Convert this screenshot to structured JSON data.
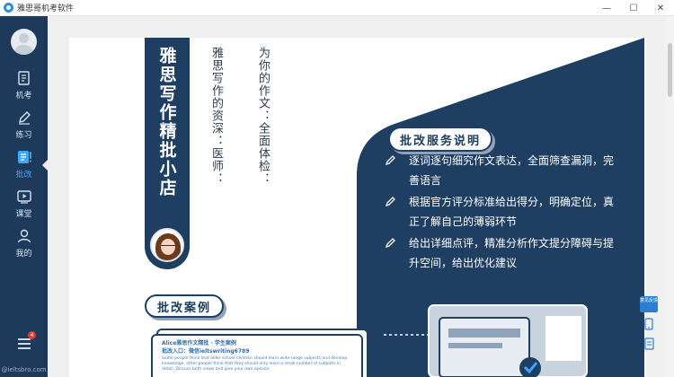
{
  "window": {
    "title": "雅思哥机考软件",
    "controls": {
      "minimize": "—",
      "maximize": "☐",
      "close": "✕"
    }
  },
  "sidebar": {
    "items": [
      {
        "label": "机考",
        "icon": "exam-icon"
      },
      {
        "label": "练习",
        "icon": "pen-icon"
      },
      {
        "label": "批改",
        "icon": "correction-icon",
        "active": true
      },
      {
        "label": "课堂",
        "icon": "video-icon"
      },
      {
        "label": "我的",
        "icon": "user-icon"
      }
    ],
    "menu_badge": "4",
    "site_url": "@ieltsbro.com"
  },
  "poster": {
    "banner_title": "雅思写作精批小店",
    "tagline_left": "雅思写作的资深：医师：",
    "tagline_right": "为你的作文：全面体检：",
    "service_title": "批改服务说明",
    "services": [
      "逐词逐句细究作文表达，全面筛查漏洞，完善语言",
      "根据官方评分标准给出得分，明确定位，真正了解自己的薄弱环节",
      "给出详细点评，精准分析作文提分障碍与提升空间，给出优化建议"
    ],
    "case_title": "批改案例",
    "sample": {
      "head_line1": "Alice雅思作文精批 · 学生案例",
      "head_line2": "批改入口：微信ieltswriting6789",
      "body": "Some people think that older school children should learn wide-range subjects and develop knowledge, other people think that they should only learn a small number of subjects in detail. Discuss both views and give your own opinion."
    }
  },
  "float_tools": {
    "feedback": "意见反馈"
  },
  "colors": {
    "navy": "#1f3f62",
    "sidebar": "#1d3a5a",
    "accent": "#3ea8ff"
  }
}
